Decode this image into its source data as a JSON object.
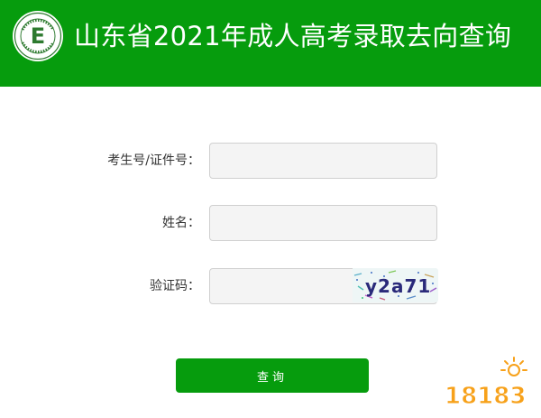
{
  "header": {
    "title": "山东省2021年成人高考录取去向查询",
    "background_color": "#069c0d",
    "logo_icon": "exam-authority-logo-icon",
    "logo_letter": "E"
  },
  "form": {
    "exam_id": {
      "label": "考生号/证件号：",
      "value": "",
      "placeholder": ""
    },
    "name": {
      "label": "姓名：",
      "value": "",
      "placeholder": ""
    },
    "captcha": {
      "label": "验证码：",
      "value": "",
      "placeholder": "",
      "image_text": "y2a71"
    },
    "submit_label": "查询"
  },
  "watermark": {
    "text": "18183",
    "colors": [
      "#f7a11a",
      "#e8311a"
    ]
  }
}
